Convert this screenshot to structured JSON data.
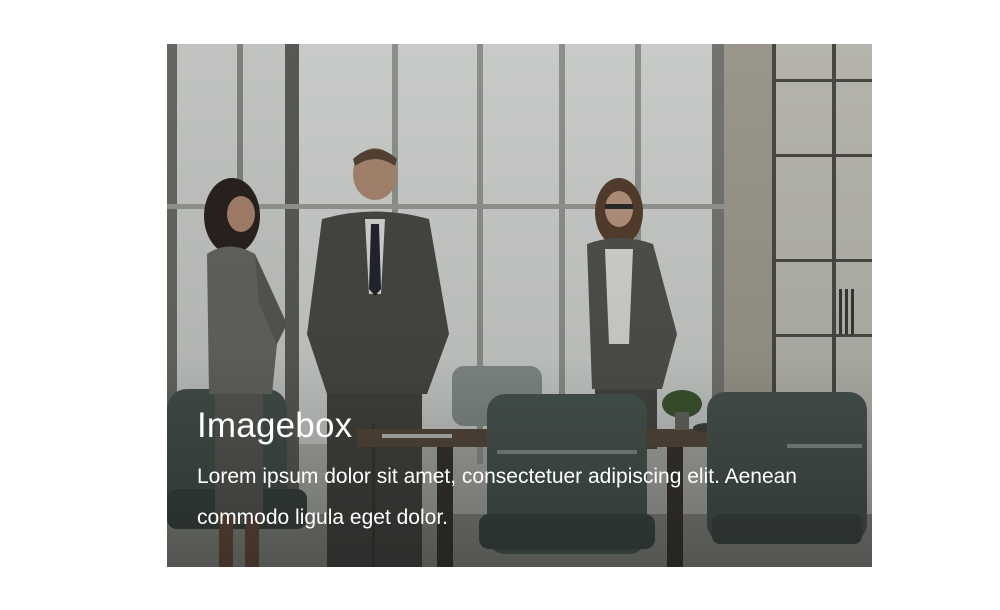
{
  "imagebox": {
    "title": "Imagebox",
    "description": "Lorem ipsum dolor sit amet, consectetuer adipiscing elit. Aenean commodo ligula eget dolor.",
    "image_alt_semantic": "office-meeting-photo"
  },
  "colors": {
    "text": "#ffffff",
    "page_background": "#ffffff"
  }
}
